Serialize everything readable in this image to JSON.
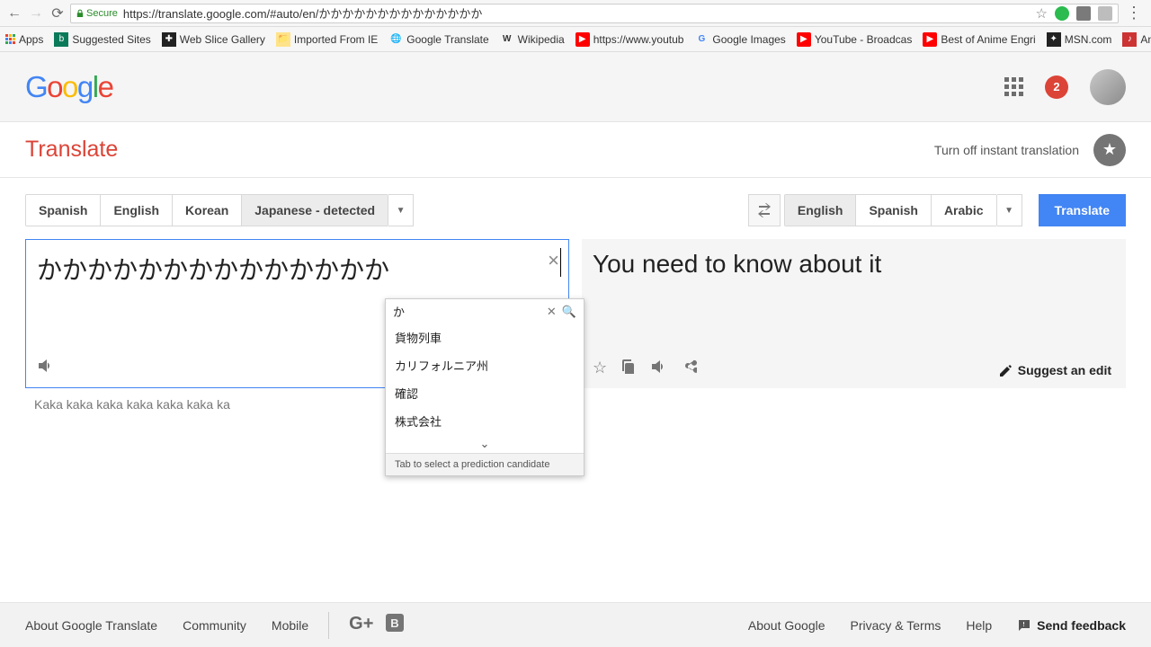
{
  "browser": {
    "secure_label": "Secure",
    "url": "https://translate.google.com/#auto/en/かかかかかかかかかかかかかか",
    "bookmarks": [
      {
        "label": "Apps",
        "name": "apps"
      },
      {
        "label": "Suggested Sites",
        "name": "suggested-sites"
      },
      {
        "label": "Web Slice Gallery",
        "name": "web-slice"
      },
      {
        "label": "Imported From IE",
        "name": "imported-ie"
      },
      {
        "label": "Google Translate",
        "name": "google-translate"
      },
      {
        "label": "Wikipedia",
        "name": "wikipedia"
      },
      {
        "label": "https://www.youtub",
        "name": "youtube-short"
      },
      {
        "label": "Google Images",
        "name": "google-images"
      },
      {
        "label": "YouTube - Broadcas",
        "name": "youtube-broadcast"
      },
      {
        "label": "Best of Anime Engri",
        "name": "best-anime"
      },
      {
        "label": "MSN.com",
        "name": "msn"
      },
      {
        "label": "Anime Lyrics dot Co",
        "name": "anime-lyrics"
      }
    ]
  },
  "header": {
    "notif_count": "2",
    "translate_label": "Translate",
    "instant_off": "Turn off instant translation"
  },
  "source": {
    "tabs": [
      "Spanish",
      "English",
      "Korean",
      "Japanese - detected"
    ],
    "selected": 3,
    "text": "かかかかかかかかかかかかかか",
    "translit": "Kaka kaka kaka kaka kaka kaka ka"
  },
  "target": {
    "tabs": [
      "English",
      "Spanish",
      "Arabic"
    ],
    "selected": 0,
    "translate_btn": "Translate",
    "text": "You need to know about it",
    "suggest_label": "Suggest an edit"
  },
  "ime": {
    "head": "か",
    "items": [
      "貨物列車",
      "カリフォルニア州",
      "確認",
      "株式会社"
    ],
    "hint": "Tab to select a prediction candidate"
  },
  "footer": {
    "left": [
      "About Google Translate",
      "Community",
      "Mobile"
    ],
    "right": [
      "About Google",
      "Privacy & Terms",
      "Help"
    ],
    "feedback": "Send feedback"
  }
}
